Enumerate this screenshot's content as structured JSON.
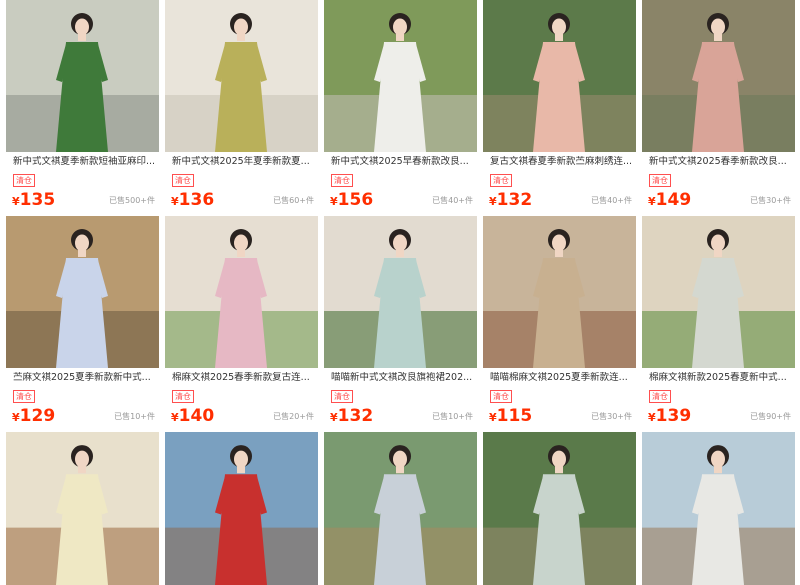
{
  "products": [
    {
      "title": "新中式文褀夏季新款短袖亚麻印...",
      "tag": "清仓",
      "currency": "¥",
      "price": "135",
      "sales": "已售500+件",
      "bg": "#c9ccc0",
      "dress": "#3f7a3a",
      "accent": "#8a8f86"
    },
    {
      "title": "新中式文褀2025年夏季新款夏...",
      "tag": "清仓",
      "currency": "¥",
      "price": "136",
      "sales": "已售60+件",
      "bg": "#e9e4da",
      "dress": "#b9b05a",
      "accent": "#c8c2b6"
    },
    {
      "title": "新中式文褀2025早春新款改良...",
      "tag": "清仓",
      "currency": "¥",
      "price": "156",
      "sales": "已售40+件",
      "bg": "#7f9a5a",
      "dress": "#eeeeea",
      "accent": "#c4c0b8"
    },
    {
      "title": "复古文褀春夏季新款苎麻刺绣连...",
      "tag": "清仓",
      "currency": "¥",
      "price": "132",
      "sales": "已售40+件",
      "bg": "#5c7a4a",
      "dress": "#e8b8a8",
      "accent": "#9a8a70"
    },
    {
      "title": "新中式文褀2025春季新款改良...",
      "tag": "清仓",
      "currency": "¥",
      "price": "149",
      "sales": "已售30+件",
      "bg": "#8a8468",
      "dress": "#d9a498",
      "accent": "#6b7a5a"
    },
    {
      "title": "苎麻文褀2025夏季新款新中式...",
      "tag": "清仓",
      "currency": "¥",
      "price": "129",
      "sales": "已售10+件",
      "bg": "#b89a70",
      "dress": "#c9d4ea",
      "accent": "#6a5a40"
    },
    {
      "title": "棉麻文褀2025春季新款复古连...",
      "tag": "清仓",
      "currency": "¥",
      "price": "140",
      "sales": "已售20+件",
      "bg": "#e6ded2",
      "dress": "#e6b8c4",
      "accent": "#6e9a4e"
    },
    {
      "title": "喵喵新中式文褀改良旗袍裙202...",
      "tag": "清仓",
      "currency": "¥",
      "price": "132",
      "sales": "已售10+件",
      "bg": "#e2dbd0",
      "dress": "#b8d2cc",
      "accent": "#3e6a2e"
    },
    {
      "title": "喵喵棉麻文褀2025夏季新款连...",
      "tag": "清仓",
      "currency": "¥",
      "price": "115",
      "sales": "已售30+件",
      "bg": "#c8b49a",
      "dress": "#c8b090",
      "accent": "#8a5a40"
    },
    {
      "title": "棉麻文褀新款2025春夏新中式...",
      "tag": "清仓",
      "currency": "¥",
      "price": "139",
      "sales": "已售90+件",
      "bg": "#ded4c0",
      "dress": "#d4d8d0",
      "accent": "#5a8a3a"
    },
    {
      "title": "",
      "tag": "",
      "currency": "",
      "price": "",
      "sales": "",
      "bg": "#e8e0cc",
      "dress": "#efe8c4",
      "accent": "#9a6a40"
    },
    {
      "title": "",
      "tag": "",
      "currency": "",
      "price": "",
      "sales": "",
      "bg": "#7aa0c0",
      "dress": "#c8302e",
      "accent": "#8a6a50"
    },
    {
      "title": "",
      "tag": "",
      "currency": "",
      "price": "",
      "sales": "",
      "bg": "#7a9a70",
      "dress": "#c8d0d8",
      "accent": "#a88a60"
    },
    {
      "title": "",
      "tag": "",
      "currency": "",
      "price": "",
      "sales": "",
      "bg": "#5a7a4a",
      "dress": "#c8d4cc",
      "accent": "#9a8a70"
    },
    {
      "title": "",
      "tag": "",
      "currency": "",
      "price": "",
      "sales": "",
      "bg": "#b8ccd8",
      "dress": "#e8e8e4",
      "accent": "#9a7a5a"
    }
  ]
}
